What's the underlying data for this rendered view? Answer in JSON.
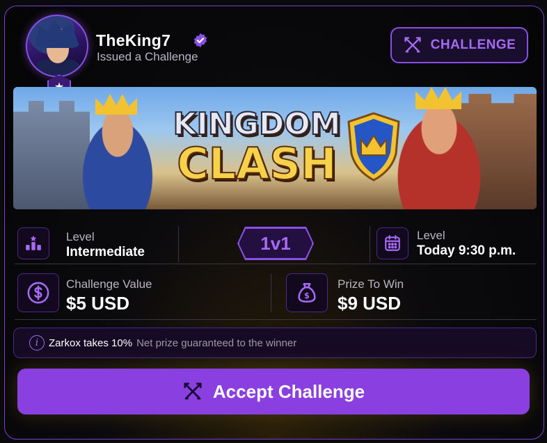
{
  "header": {
    "username": "TheKing7",
    "subtitle": "Issued a Challenge",
    "badge_symbol": "★",
    "challenge_button": "CHALLENGE"
  },
  "banner": {
    "title_line1": "KINGDOM",
    "title_line2": "CLASH"
  },
  "stats": {
    "level_label": "Level",
    "level_value": "Intermediate",
    "mode": "1v1",
    "time_label": "Level",
    "time_value": "Today 9:30 p.m.",
    "challenge_value_label": "Challenge Value",
    "challenge_value": "$5 USD",
    "prize_label": "Prize To Win",
    "prize_value": "$9 USD"
  },
  "fee": {
    "info_glyph": "i",
    "strong": "Zarkox takes 10%",
    "muted": "Net prize guaranteed to the winner"
  },
  "accept_button": "Accept Challenge",
  "colors": {
    "accent": "#8a3fe0",
    "accent_light": "#a66bf5",
    "border": "#7b3fd6",
    "background": "#0a0a0c"
  }
}
